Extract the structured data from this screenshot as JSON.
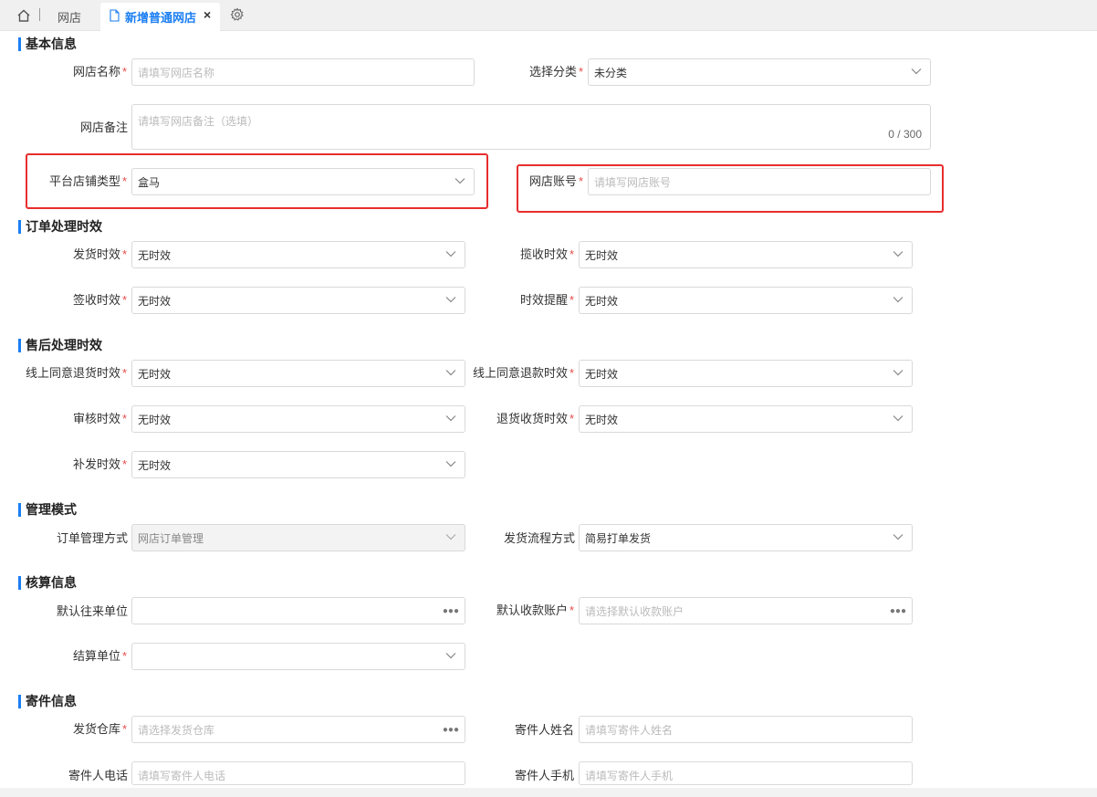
{
  "tabs": {
    "home_icon": "home-icon",
    "tab1": "网店",
    "active_tab": "新增普通网店",
    "close": "×",
    "settings_icon": "gear-icon"
  },
  "sections": {
    "basic": "基本信息",
    "order": "订单处理时效",
    "after_sale": "售后处理时效",
    "management": "管理模式",
    "accounting": "核算信息",
    "shipping": "寄件信息"
  },
  "required_mark": "*",
  "fields": {
    "shop_name": {
      "label": "网店名称",
      "placeholder": "请填写网店名称"
    },
    "category": {
      "label": "选择分类",
      "value": "未分类"
    },
    "remark": {
      "label": "网店备注",
      "placeholder": "请填写网店备注（选填）",
      "count": "0 / 300"
    },
    "platform_type": {
      "label": "平台店铺类型",
      "value": "盒马"
    },
    "shop_account": {
      "label": "网店账号",
      "placeholder": "请填写网店账号"
    },
    "ship_time": {
      "label": "发货时效",
      "value": "无时效"
    },
    "pickup_time": {
      "label": "揽收时效",
      "value": "无时效"
    },
    "sign_time": {
      "label": "签收时效",
      "value": "无时效"
    },
    "time_alert": {
      "label": "时效提醒",
      "value": "无时效"
    },
    "online_return_goods": {
      "label": "线上同意退货时效",
      "value": "无时效"
    },
    "online_refund": {
      "label": "线上同意退款时效",
      "value": "无时效"
    },
    "audit_time": {
      "label": "审核时效",
      "value": "无时效"
    },
    "return_receive": {
      "label": "退货收货时效",
      "value": "无时效"
    },
    "reship_time": {
      "label": "补发时效",
      "value": "无时效"
    },
    "order_mgmt": {
      "label": "订单管理方式",
      "value": "网店订单管理"
    },
    "ship_flow": {
      "label": "发货流程方式",
      "value": "简易打单发货"
    },
    "default_partner": {
      "label": "默认往来单位",
      "value": ""
    },
    "default_account": {
      "label": "默认收款账户",
      "placeholder": "请选择默认收款账户"
    },
    "settle_unit": {
      "label": "结算单位",
      "value": ""
    },
    "ship_warehouse": {
      "label": "发货仓库",
      "placeholder": "请选择发货仓库"
    },
    "sender_name": {
      "label": "寄件人姓名",
      "placeholder": "请填写寄件人姓名"
    },
    "sender_phone": {
      "label": "寄件人电话",
      "placeholder": "请填写寄件人电话"
    },
    "sender_mobile": {
      "label": "寄件人手机",
      "placeholder": "请填写寄件人手机"
    }
  },
  "colors": {
    "accent": "#1a7ef2",
    "required": "#e64b4b",
    "highlight": "#e82d2d"
  }
}
